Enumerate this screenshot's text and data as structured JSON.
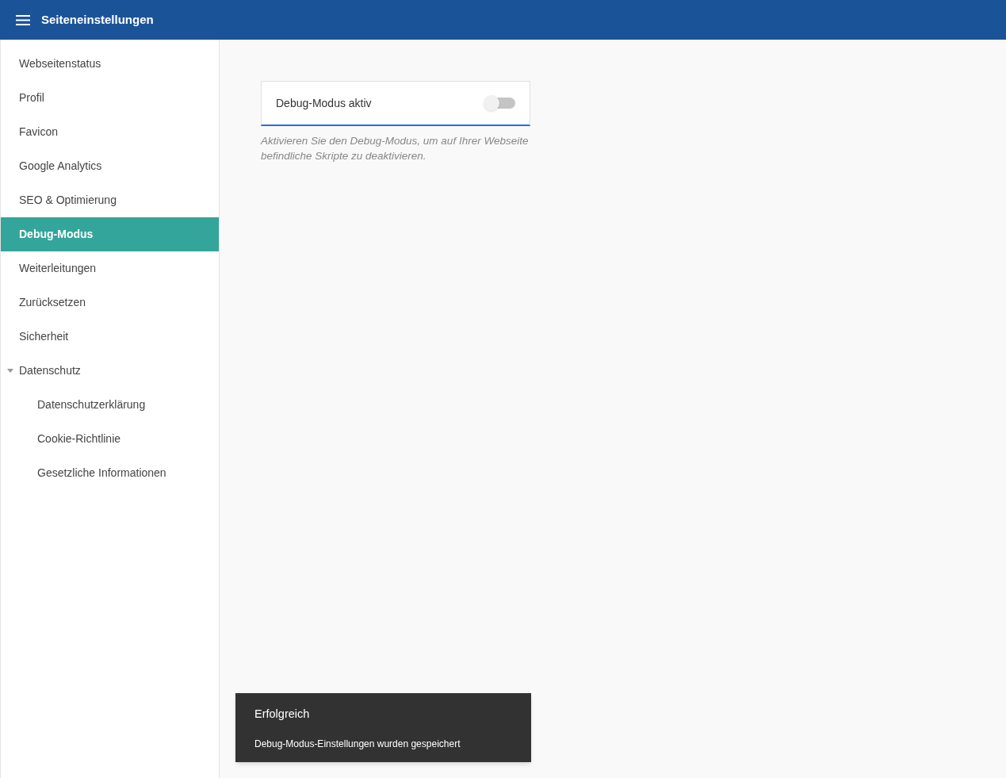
{
  "header": {
    "title": "Seiteneinstellungen"
  },
  "sidebar": {
    "items": [
      {
        "label": "Webseitenstatus",
        "selected": false
      },
      {
        "label": "Profil",
        "selected": false
      },
      {
        "label": "Favicon",
        "selected": false
      },
      {
        "label": "Google Analytics",
        "selected": false
      },
      {
        "label": "SEO & Optimierung",
        "selected": false
      },
      {
        "label": "Debug-Modus",
        "selected": true
      },
      {
        "label": "Weiterleitungen",
        "selected": false
      },
      {
        "label": "Zurücksetzen",
        "selected": false
      },
      {
        "label": "Sicherheit",
        "selected": false
      },
      {
        "label": "Datenschutz",
        "selected": false,
        "expanded": true,
        "children": [
          {
            "label": "Datenschutzerklärung",
            "selected": false
          },
          {
            "label": "Cookie-Richtlinie",
            "selected": false
          },
          {
            "label": "Gesetzliche Informationen",
            "selected": false
          }
        ]
      }
    ]
  },
  "setting": {
    "label": "Debug-Modus aktiv",
    "on": false,
    "hint": "Aktivieren Sie den Debug-Modus, um auf Ihrer Webseite befindliche Skripte zu deaktivieren."
  },
  "toast": {
    "title": "Erfolgreich",
    "message": "Debug-Modus-Einstellungen wurden gespeichert"
  }
}
